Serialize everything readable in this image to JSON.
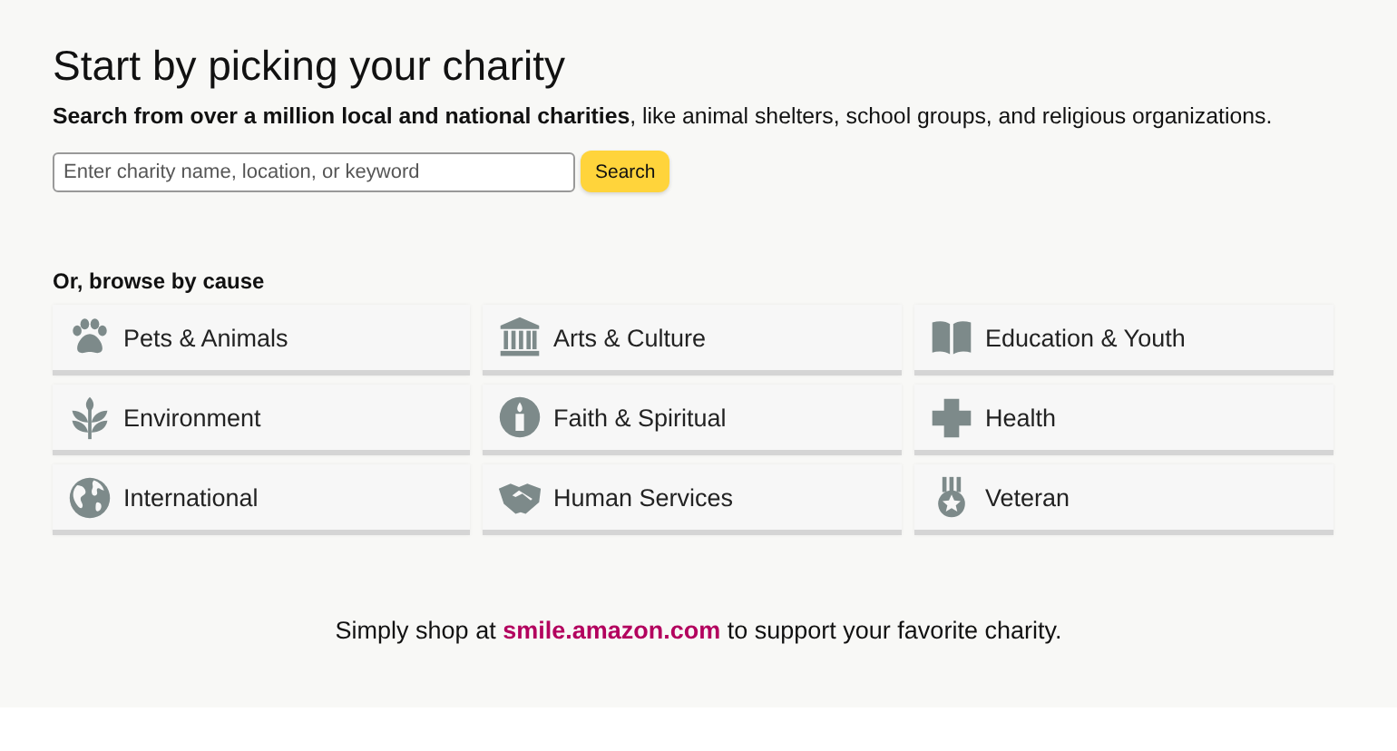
{
  "heading": "Start by picking your charity",
  "subheading": "**Search from over a million local and national charities**, like animal shelters, school groups, and religious organizations.",
  "search": {
    "placeholder": "Enter charity name, location, or keyword",
    "button": "Search"
  },
  "browse_label": "Or, browse by cause",
  "causes": [
    {
      "label": "Pets & Animals"
    },
    {
      "label": "Arts & Culture"
    },
    {
      "label": "Education & Youth"
    },
    {
      "label": "Environment"
    },
    {
      "label": "Faith & Spiritual"
    },
    {
      "label": "Health"
    },
    {
      "label": "International"
    },
    {
      "label": "Human Services"
    },
    {
      "label": "Veteran"
    }
  ],
  "footer": {
    "before": "Simply shop at ",
    "link": "smile.amazon.com",
    "after": " to support your favorite charity."
  }
}
